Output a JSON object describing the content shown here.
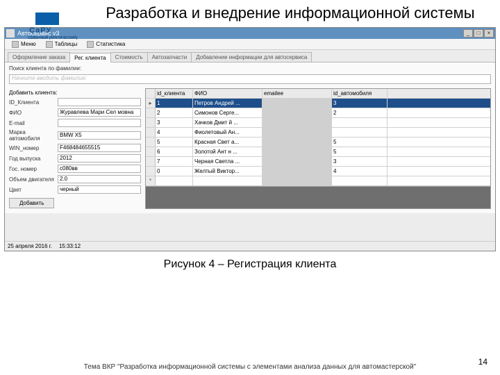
{
  "slide": {
    "title": "Разработка и внедрение информационной системы",
    "logo_badge": "СаРУ",
    "logo_sub": "СЕВЕРНЫЙ (АРКТИЧЕСКИЙ)",
    "caption": "Рисунок 4 – Регистрация клиента",
    "footer": "Тема ВКР \"Разработка информационной системы с элементами анализа данных для автомастерской\"",
    "page": "14"
  },
  "window": {
    "title": "Автосервис v3",
    "menus": [
      "Меню",
      "Таблицы",
      "Статистика"
    ],
    "tabs": [
      "Оформление заказа",
      "Рег. клиента",
      "Стоимость",
      "Автозапчасти",
      "Добавление информации для автосервиса"
    ],
    "active_tab": 1
  },
  "search": {
    "label": "Поиск клиента по фамилии:",
    "placeholder": "Начните вводить фамилию"
  },
  "form_header": "Добавить клиента:",
  "form": [
    {
      "label": "ID_Клиента",
      "value": ""
    },
    {
      "label": "ФИО",
      "value": "Журавлева Мари  Сел мовна"
    },
    {
      "label": "E-mail",
      "value": ""
    },
    {
      "label": "Марка автомобиля",
      "value": "BMW X5"
    },
    {
      "label": "WIN_номер",
      "value": "F468484655515"
    },
    {
      "label": "Год выпуска",
      "value": "2012"
    },
    {
      "label": "Гос. номер",
      "value": "с080вв"
    },
    {
      "label": "Объем двигателя",
      "value": "2.0"
    },
    {
      "label": "Цвет",
      "value": "черный"
    }
  ],
  "add_button": "Добавить",
  "grid": {
    "cols": [
      "id_клиента",
      "ФИО",
      "emailee",
      "id_автомобиля"
    ],
    "rows": [
      {
        "id": "1",
        "fio": "Петров Андрей ...",
        "auto": "3"
      },
      {
        "id": "2",
        "fio": "Симонов Серге...",
        "auto": "2"
      },
      {
        "id": "3",
        "fio": "Хачков Дмит й ...",
        "auto": ""
      },
      {
        "id": "4",
        "fio": "Фиолетовый Ан...",
        "auto": ""
      },
      {
        "id": "5",
        "fio": "Красная Свет а...",
        "auto": "5"
      },
      {
        "id": "6",
        "fio": "Золотой Ант н ...",
        "auto": "5"
      },
      {
        "id": "7",
        "fio": "Черная Светла ...",
        "auto": "3"
      },
      {
        "id": "0",
        "fio": "Желтый Виктор...",
        "auto": "4"
      }
    ]
  },
  "status": {
    "date": "25 апреля 2016 г.",
    "time": "15:33:12"
  }
}
